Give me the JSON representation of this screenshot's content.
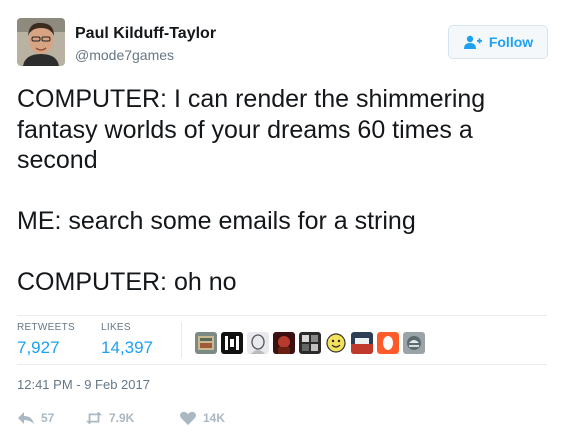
{
  "author": {
    "name": "Paul Kilduff-Taylor",
    "handle": "@mode7games"
  },
  "follow_button": {
    "label": "Follow",
    "icon": "add-user-icon"
  },
  "tweet": {
    "lines": [
      "COMPUTER: I can render the shimmering",
      "fantasy worlds of your dreams 60 times a",
      "second",
      "",
      "ME: search some emails for a string",
      "",
      "COMPUTER: oh no"
    ]
  },
  "stats": {
    "retweets_label": "RETWEETS",
    "retweets_value": "7,927",
    "likes_label": "LIKES",
    "likes_value": "14,397"
  },
  "timestamp": "12:41 PM - 9 Feb 2017",
  "actions": {
    "reply": {
      "icon": "reply-icon",
      "count": "57"
    },
    "retweet": {
      "icon": "retweet-icon",
      "count": "7.9K"
    },
    "like": {
      "icon": "heart-icon",
      "count": "14K"
    }
  },
  "colors": {
    "accent": "#1da1f2",
    "muted": "#657786",
    "icon_muted": "#aab8c2",
    "divider": "#e6ecf0"
  }
}
